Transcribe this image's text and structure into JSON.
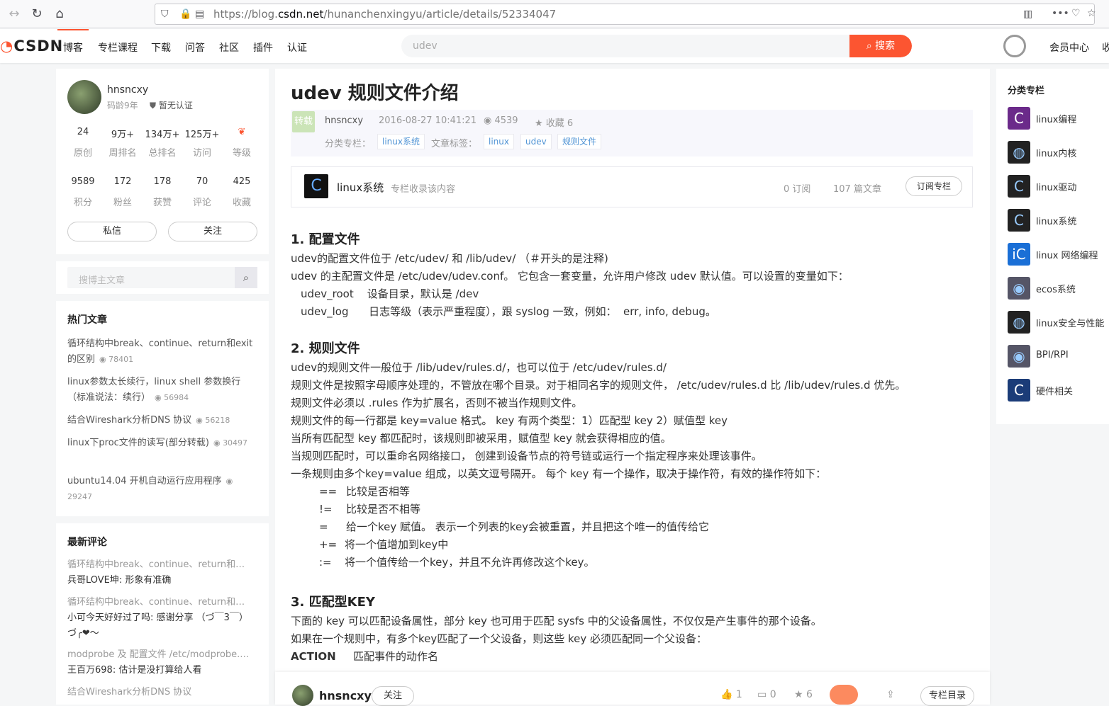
{
  "browser": {
    "url_prefix": "https://blog.",
    "url_host": "csdn.net",
    "url_path": "/hunanchenxingyu/article/details/52334047"
  },
  "topnav": {
    "logo": "CSDN",
    "items": [
      "博客",
      "专栏课程",
      "下载",
      "问答",
      "社区",
      "插件",
      "认证"
    ],
    "search_placeholder": "udev",
    "search_button": "搜索",
    "member_center": "会员中心",
    "favorites": "收"
  },
  "profile": {
    "name": "hnsncxy",
    "age": "码龄9年",
    "cert": "暂无认证",
    "stats_row1": [
      {
        "value": "24",
        "label": "原创"
      },
      {
        "value": "9万+",
        "label": "周排名"
      },
      {
        "value": "134万+",
        "label": "总排名"
      },
      {
        "value": "125万+",
        "label": "访问"
      },
      {
        "value": "",
        "label": "等级"
      }
    ],
    "stats_row2": [
      {
        "value": "9589",
        "label": "积分"
      },
      {
        "value": "172",
        "label": "粉丝"
      },
      {
        "value": "178",
        "label": "获赞"
      },
      {
        "value": "70",
        "label": "评论"
      },
      {
        "value": "425",
        "label": "收藏"
      }
    ],
    "message_button": "私信",
    "follow_button": "关注"
  },
  "sidebar_search": {
    "placeholder": "搜博主文章"
  },
  "hot_articles": {
    "heading": "热门文章",
    "items": [
      {
        "title": "循环结构中break、continue、return和exit的区别",
        "views": "78401"
      },
      {
        "title": "linux参数太长续行，linux shell 参数换行（标准说法：续行）",
        "views": "56984"
      },
      {
        "title": "结合Wireshark分析DNS 协议",
        "views": "56218"
      },
      {
        "title": "linux下proc文件的读写(部分转载)",
        "views": "30497"
      },
      {
        "title": "ubuntu14.04 开机自动运行应用程序",
        "views": "29247"
      }
    ]
  },
  "recent_comments": {
    "heading": "最新评论",
    "items": [
      {
        "article": "循环结构中break、continue、return和…",
        "comment": "兵哥LOVE坤: 形象有准确"
      },
      {
        "article": "循环结构中break、continue、return和…",
        "comment": "小可今天好好过了吗: 感谢分享 （づ￣3￣）づ╭❤～"
      },
      {
        "article": "modprobe 及 配置文件 /etc/modprobe.…",
        "comment": "王百万698: 估计是没打算给人看"
      },
      {
        "article": "结合Wireshark分析DNS 协议",
        "comment": ""
      }
    ]
  },
  "article": {
    "title": "udev  规则文件介绍",
    "badge": "转载",
    "author": "hnsncxy",
    "date": "2016-08-27 10:41:21",
    "views": "4539",
    "favorites": "收藏 6",
    "category_label": "分类专栏：",
    "category": "linux系统",
    "tags_label": "文章标签：",
    "tags": [
      "linux",
      "udev",
      "规则文件"
    ],
    "column": {
      "name": "linux系统",
      "note": "专栏收录该内容",
      "subs": "0 订阅",
      "count": "107 篇文章",
      "button": "订阅专栏"
    },
    "s1_title": "1. 配置文件",
    "s1_lines": [
      "udev的配置文件位于 /etc/udev/ 和 /lib/udev/ （＃开头的是注释)",
      "udev 的主配置文件是 /etc/udev/udev.conf。 它包含一套变量，允许用户修改 udev 默认值。可以设置的变量如下：",
      "udev_root    设备目录，默认是 /dev",
      "udev_log      日志等级（表示严重程度），跟 syslog 一致，例如：  err, info, debug。"
    ],
    "s2_title": "2. 规则文件",
    "s2_lines": [
      "udev的规则文件一般位于 /lib/udev/rules.d/，也可以位于  /etc/udev/rules.d/",
      "规则文件是按照字母顺序处理的，不管放在哪个目录。对于相同名字的规则文件， /etc/udev/rules.d 比  /lib/udev/rules.d 优先。",
      "规则文件必须以 .rules 作为扩展名，否则不被当作规则文件。",
      "规则文件的每一行都是 key=value 格式。 key 有两个类型：1）匹配型 key   2）赋值型 key",
      "当所有匹配型 key 都匹配时，该规则即被采用，赋值型 key 就会获得相应的值。",
      "当规则匹配时，可以重命名网络接口，  创建到设备节点的符号链或运行一个指定程序来处理该事件。",
      "一条规则由多个key=value 组成，以英文逗号隔开。  每个 key 有一个操作，取决于操作符，有效的操作符如下："
    ],
    "operators": [
      {
        "op": "==",
        "desc": "比较是否相等"
      },
      {
        "op": "!=",
        "desc": "比较是否不相等"
      },
      {
        "op": "=",
        "desc": "给一个key 赋值。 表示一个列表的key会被重置，并且把这个唯一的值传给它"
      },
      {
        "op": "+=",
        "desc": "将一个值增加到key中"
      },
      {
        "op": ":=",
        "desc": "将一个值传给一个key，并且不允许再修改这个key。"
      }
    ],
    "s3_title": "3. 匹配型KEY",
    "s3_lines": [
      "下面的 key 可以匹配设备属性，部分 key 也可用于匹配 sysfs 中的父设备属性，不仅仅是产生事件的那个设备。",
      "如果在一个规则中，有多个key匹配了一个父设备，则这些 key 必须匹配同一个父设备："
    ],
    "action_key": "ACTION",
    "action_desc": "匹配事件的动作名"
  },
  "bottom_bar": {
    "author": "hnsncxy",
    "follow": "关注",
    "likes": "1",
    "comments": "0",
    "stars": "6",
    "toc": "专栏目录"
  },
  "right_columns": {
    "heading": "分类专栏",
    "items": [
      "linux编程",
      "linux内核",
      "linux驱动",
      "linux系统",
      "linux 网络编程",
      "ecos系统",
      "linux安全与性能",
      "BPI/RPI",
      "硬件相关"
    ]
  }
}
